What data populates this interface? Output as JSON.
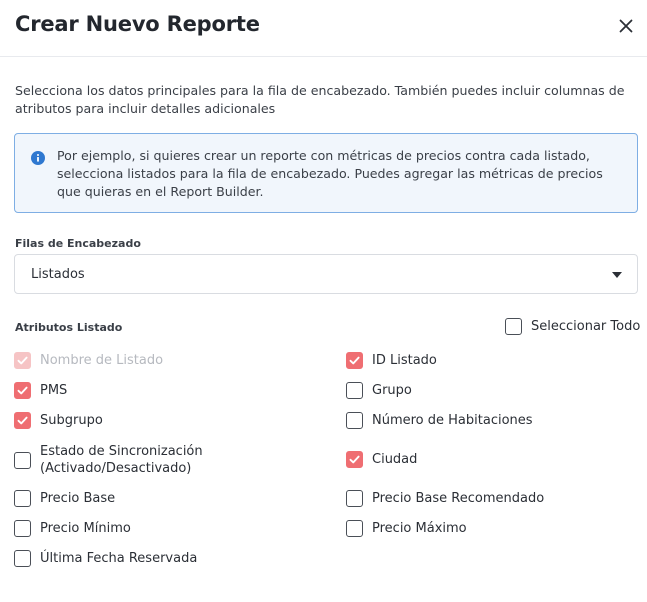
{
  "dialog": {
    "title": "Crear Nuevo Reporte",
    "intro": "Selecciona los datos principales para la fila de encabezado. También puedes incluir columnas de atributos para incluir detalles adicionales",
    "info": "Por ejemplo, si quieres crear un reporte con métricas de precios contra cada listado, selecciona listados para la fila de encabezado. Puedes agregar las métricas de precios que quieras en el Report Builder."
  },
  "header_rows": {
    "label": "Filas de Encabezado",
    "value": "Listados"
  },
  "attributes": {
    "label": "Atributos Listado",
    "select_all": "Seleccionar Todo",
    "left": [
      {
        "label": "Nombre de Listado",
        "checked": true,
        "disabled": true
      },
      {
        "label": "PMS",
        "checked": true
      },
      {
        "label": "Subgrupo",
        "checked": true
      },
      {
        "label": "Estado de Sincronización (Activado/Desactivado)",
        "checked": false
      },
      {
        "label": "Precio Base",
        "checked": false
      },
      {
        "label": "Precio Mínimo",
        "checked": false
      },
      {
        "label": "Última Fecha Reservada",
        "checked": false
      }
    ],
    "right": [
      {
        "label": "ID Listado",
        "checked": true
      },
      {
        "label": "Grupo",
        "checked": false
      },
      {
        "label": "Número de Habitaciones",
        "checked": false
      },
      {
        "label": "Ciudad",
        "checked": true
      },
      {
        "label": "Precio Base Recomendado",
        "checked": false
      },
      {
        "label": "Precio Máximo",
        "checked": false
      }
    ]
  },
  "colors": {
    "accent": "#ef6e72",
    "accent_disabled": "#f6c4c5",
    "info_border": "#7eaee4",
    "info_bg": "#f1f6fc",
    "info_icon": "#2f78d0"
  }
}
